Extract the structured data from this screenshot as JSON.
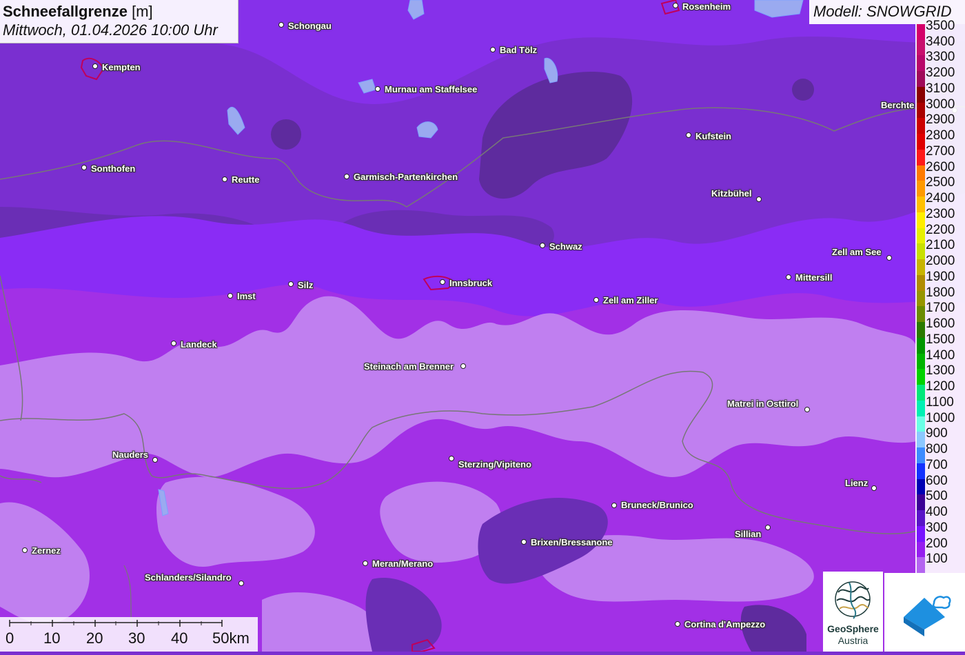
{
  "title": {
    "main": "Schneefallgrenze",
    "unit": "[m]",
    "datetime": "Mittwoch, 01.04.2026 10:00 Uhr"
  },
  "model": "Modell: SNOWGRID",
  "legend": {
    "levels": [
      {
        "label": "3500",
        "color": "#d4006a"
      },
      {
        "label": "3400",
        "color": "#c8106e"
      },
      {
        "label": "3300",
        "color": "#b8086a"
      },
      {
        "label": "3200",
        "color": "#a00a5a"
      },
      {
        "label": "3100",
        "color": "#8a0000"
      },
      {
        "label": "3000",
        "color": "#aa0000"
      },
      {
        "label": "2900",
        "color": "#cc0000"
      },
      {
        "label": "2800",
        "color": "#e00000"
      },
      {
        "label": "2700",
        "color": "#ff1a1a"
      },
      {
        "label": "2600",
        "color": "#ff7a00"
      },
      {
        "label": "2500",
        "color": "#ff9a00"
      },
      {
        "label": "2400",
        "color": "#ffc000"
      },
      {
        "label": "2300",
        "color": "#ffee00"
      },
      {
        "label": "2200",
        "color": "#e6f000"
      },
      {
        "label": "2100",
        "color": "#c8e000"
      },
      {
        "label": "2000",
        "color": "#c8b400"
      },
      {
        "label": "1900",
        "color": "#b08c00"
      },
      {
        "label": "1800",
        "color": "#969600"
      },
      {
        "label": "1700",
        "color": "#6a8c00"
      },
      {
        "label": "1600",
        "color": "#2a7a00"
      },
      {
        "label": "1500",
        "color": "#009600"
      },
      {
        "label": "1400",
        "color": "#00b400"
      },
      {
        "label": "1300",
        "color": "#00d200"
      },
      {
        "label": "1200",
        "color": "#00e87a"
      },
      {
        "label": "1100",
        "color": "#00f0b4"
      },
      {
        "label": "1000",
        "color": "#6affe6"
      },
      {
        "label": "900",
        "color": "#8cc8ff"
      },
      {
        "label": "800",
        "color": "#3c8cff"
      },
      {
        "label": "700",
        "color": "#1432ff"
      },
      {
        "label": "600",
        "color": "#0000b4"
      },
      {
        "label": "500",
        "color": "#3c0096"
      },
      {
        "label": "400",
        "color": "#5a14c8"
      },
      {
        "label": "300",
        "color": "#7814ff"
      },
      {
        "label": "200",
        "color": "#961ef0"
      },
      {
        "label": "100",
        "color": "#b464f0"
      }
    ]
  },
  "scale": {
    "ticks": [
      "0",
      "10",
      "20",
      "30",
      "40",
      "50km"
    ]
  },
  "cities": [
    {
      "name": "Rosenheim"
    },
    {
      "name": "Schongau"
    },
    {
      "name": "Kempten"
    },
    {
      "name": "Bad Tölz"
    },
    {
      "name": "Murnau am Staffelsee"
    },
    {
      "name": "Berchte"
    },
    {
      "name": "Kufstein"
    },
    {
      "name": "Sonthofen"
    },
    {
      "name": "Reutte"
    },
    {
      "name": "Garmisch-Partenkirchen"
    },
    {
      "name": "Kitzbühel"
    },
    {
      "name": "Schwaz"
    },
    {
      "name": "Zell am See"
    },
    {
      "name": "Silz"
    },
    {
      "name": "Innsbruck"
    },
    {
      "name": "Mittersill"
    },
    {
      "name": "Imst"
    },
    {
      "name": "Zell am Ziller"
    },
    {
      "name": "Landeck"
    },
    {
      "name": "Steinach am Brenner"
    },
    {
      "name": "Matrei in Osttirol"
    },
    {
      "name": "Nauders"
    },
    {
      "name": "Sterzing/Vipiteno"
    },
    {
      "name": "Lienz"
    },
    {
      "name": "Bruneck/Brunico"
    },
    {
      "name": "Sillian"
    },
    {
      "name": "Brixen/Bressanone"
    },
    {
      "name": "Zernez"
    },
    {
      "name": "Meran/Merano"
    },
    {
      "name": "Schlanders/Silandro"
    },
    {
      "name": "Cortina d'Ampezzo"
    }
  ],
  "logos": {
    "geosphere_name": "GeoSphere",
    "geosphere_sub": "Austria"
  },
  "colors": {
    "dark": "#5a2a9e",
    "mid": "#7a2fd0",
    "bright": "#8a2cf5",
    "magenta": "#a230e6",
    "light": "#c07ff0",
    "border": "#777777"
  }
}
